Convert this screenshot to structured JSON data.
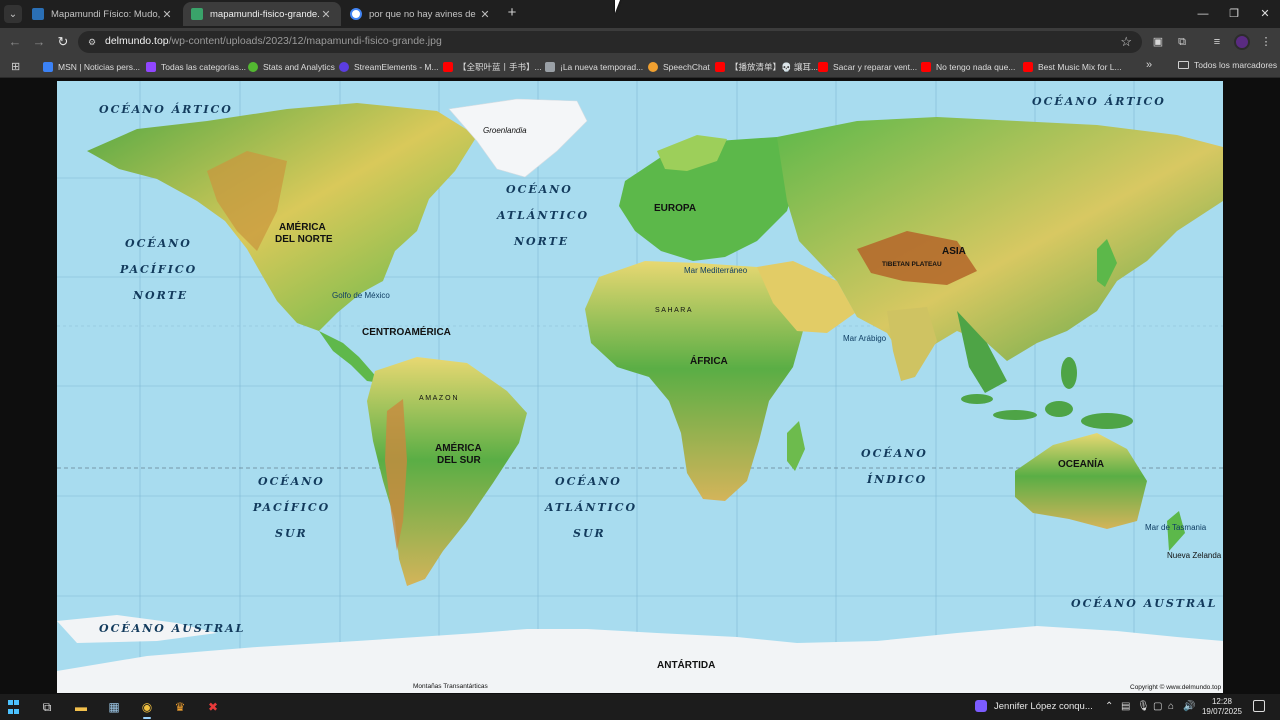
{
  "tabs": [
    {
      "title": "Mapamundi Físico: Mudo, para",
      "active": false,
      "color": "#2a6fb5"
    },
    {
      "title": "mapamundi-fisico-grande.jpg",
      "active": true,
      "color": "#3aa36a"
    },
    {
      "title": "por que no hay avines de latina",
      "active": false,
      "color": "#4285f4"
    }
  ],
  "toolbar": {
    "url_host": "delmundo.top",
    "url_path": "/wp-content/uploads/2023/12/mapamundi-fisico-grande.jpg"
  },
  "bookmarks": {
    "items": [
      {
        "label": "MSN | Noticias pers...",
        "color": "#3b82f6"
      },
      {
        "label": "Todas las categorías...",
        "color": "#9146ff"
      },
      {
        "label": "Stats and Analytics",
        "color": "#53b831"
      },
      {
        "label": "StreamElements - M...",
        "color": "#5b3de0"
      },
      {
        "label": "【全职叶蓝丨手书】...",
        "color": "#ff0000"
      },
      {
        "label": "¡La nueva temporad...",
        "color": "#9aa0a6"
      },
      {
        "label": "SpeechChat",
        "color": "#f0a030"
      },
      {
        "label": "【播放清单】💀 讓耳...",
        "color": "#ff0000"
      },
      {
        "label": "Sacar y reparar vent...",
        "color": "#ff0000"
      },
      {
        "label": "No tengo nada que...",
        "color": "#ff0000"
      },
      {
        "label": "Best Music Mix for L...",
        "color": "#ff0000"
      }
    ],
    "more": "»",
    "all_bookmarks": "Todos los marcadores"
  },
  "map": {
    "oceans": {
      "artico_left": "OCÉANO ÁRTICO",
      "artico_right": "OCÉANO ÁRTICO",
      "pacifico_norte_1": "OCÉANO",
      "pacifico_norte_2": "PACÍFICO",
      "pacifico_norte_3": "NORTE",
      "atlantico_norte_1": "OCÉANO",
      "atlantico_norte_2": "ATLÁNTICO",
      "atlantico_norte_3": "NORTE",
      "pacifico_sur_1": "OCÉANO",
      "pacifico_sur_2": "PACÍFICO",
      "pacifico_sur_3": "SUR",
      "atlantico_sur_1": "OCÉANO",
      "atlantico_sur_2": "ATLÁNTICO",
      "atlantico_sur_3": "SUR",
      "indico_1": "OCÉANO",
      "indico_2": "ÍNDICO",
      "austral_left": "OCÉANO AUSTRAL",
      "austral_right": "OCÉANO AUSTRAL"
    },
    "continents": {
      "america_norte_1": "AMÉRICA",
      "america_norte_2": "DEL NORTE",
      "centroamerica": "CENTROAMÉRICA",
      "america_sur_1": "AMÉRICA",
      "america_sur_2": "DEL SUR",
      "europa": "EUROPA",
      "africa": "ÁFRICA",
      "asia": "ASIA",
      "oceania": "OCEANÍA",
      "antartida": "ANTÁRTIDA"
    },
    "places": {
      "groenlandia": "Groenlandia",
      "mar_mediterraneo": "Mar Mediterráneo",
      "golfo_mexico": "Golfo de México",
      "mar_arabigo": "Mar Arábigo",
      "mar_tasmania": "Mar de Tasmania",
      "nueva_zelanda": "Nueva Zelanda",
      "montanas": "Montañas Transantárticas",
      "tibet": "TIBETAN PLATEAU",
      "sahara": "S A H A R A",
      "amazon": "A M A Z O N"
    },
    "credit": "Copyright © www.delmundo.top",
    "colors": {
      "ocean": "#a8dcef",
      "land_green": "#5cb84a",
      "land_yellow": "#e5d86a",
      "land_brown": "#c98a3e",
      "ice": "#f2f4f6"
    }
  },
  "taskbar": {
    "media_title": "Jennifer López conqu...",
    "time": "12:28",
    "date": "19/07/2025"
  }
}
